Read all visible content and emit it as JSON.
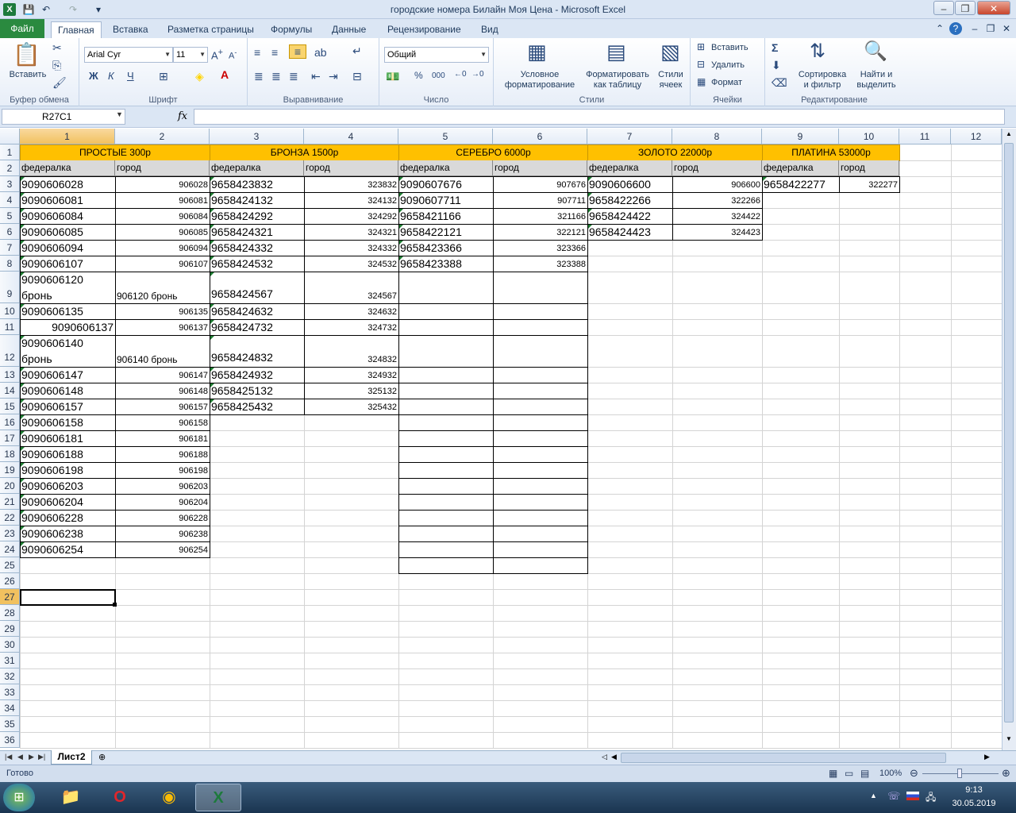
{
  "window": {
    "title": "городские номера Билайн Моя Цена  -  Microsoft Excel",
    "minimize": "–",
    "restore": "❐",
    "close": "✕"
  },
  "ribbon_tabs": [
    "Файл",
    "Главная",
    "Вставка",
    "Разметка страницы",
    "Формулы",
    "Данные",
    "Рецензирование",
    "Вид"
  ],
  "ribbon": {
    "paste": "Вставить",
    "clipboard": "Буфер обмена",
    "font_name": "Arial Cyr",
    "font_size": "11",
    "bold": "Ж",
    "italic": "К",
    "underline": "Ч",
    "font_group": "Шрифт",
    "align_group": "Выравнивание",
    "number_format": "Общий",
    "percent": "%",
    "thousands": "000",
    "number_group": "Число",
    "cond_format_1": "Условное",
    "cond_format_2": "форматирование",
    "format_table_1": "Форматировать",
    "format_table_2": "как таблицу",
    "cell_styles_1": "Стили",
    "cell_styles_2": "ячеек",
    "styles_group": "Стили",
    "insert": "Вставить",
    "delete": "Удалить",
    "format": "Формат",
    "cells_group": "Ячейки",
    "sort_1": "Сортировка",
    "sort_2": "и фильтр",
    "find_1": "Найти и",
    "find_2": "выделить",
    "edit_group": "Редактирование"
  },
  "formula_bar": {
    "name_box": "R27C1",
    "fx": "fx",
    "formula": ""
  },
  "columns": [
    "1",
    "2",
    "3",
    "4",
    "5",
    "6",
    "7",
    "8",
    "9",
    "10",
    "11",
    "12"
  ],
  "rows": [
    "1",
    "2",
    "3",
    "4",
    "5",
    "6",
    "7",
    "8",
    "9",
    "10",
    "11",
    "12",
    "13",
    "14",
    "15",
    "16",
    "17",
    "18",
    "19",
    "20",
    "21",
    "22",
    "23",
    "24",
    "25",
    "26",
    "27",
    "28",
    "29",
    "30",
    "31",
    "32",
    "33",
    "34",
    "35",
    "36"
  ],
  "headers": {
    "prostye": "ПРОСТЫЕ 300р",
    "bronza": "БРОНЗА 1500р",
    "serebro": "СЕРЕБРО 6000р",
    "zoloto": "ЗОЛОТО 22000р",
    "platina": "ПЛАТИНА 53000р",
    "federalka": "федералка",
    "gorod": "город"
  },
  "data": {
    "prostye": [
      [
        "9090606028",
        "906028"
      ],
      [
        "9090606081",
        "906081"
      ],
      [
        "9090606084",
        "906084"
      ],
      [
        "9090606085",
        "906085"
      ],
      [
        "9090606094",
        "906094"
      ],
      [
        "9090606107",
        "906107"
      ],
      [
        "9090606120 бронь",
        "906120 бронь"
      ],
      [
        "9090606135",
        "906135"
      ],
      [
        "9090606137",
        "906137"
      ],
      [
        "9090606140 бронь",
        "906140 бронь"
      ],
      [
        "9090606147",
        "906147"
      ],
      [
        "9090606148",
        "906148"
      ],
      [
        "9090606157",
        "906157"
      ],
      [
        "9090606158",
        "906158"
      ],
      [
        "9090606181",
        "906181"
      ],
      [
        "9090606188",
        "906188"
      ],
      [
        "9090606198",
        "906198"
      ],
      [
        "9090606203",
        "906203"
      ],
      [
        "9090606204",
        "906204"
      ],
      [
        "9090606228",
        "906228"
      ],
      [
        "9090606238",
        "906238"
      ],
      [
        "9090606254",
        "906254"
      ]
    ],
    "bronza": [
      [
        "9658423832",
        "323832"
      ],
      [
        "9658424132",
        "324132"
      ],
      [
        "9658424292",
        "324292"
      ],
      [
        "9658424321",
        "324321"
      ],
      [
        "9658424332",
        "324332"
      ],
      [
        "9658424532",
        "324532"
      ],
      [
        "9658424567",
        "324567"
      ],
      [
        "9658424632",
        "324632"
      ],
      [
        "9658424732",
        "324732"
      ],
      [
        "9658424832",
        "324832"
      ],
      [
        "9658424932",
        "324932"
      ],
      [
        "9658425132",
        "325132"
      ],
      [
        "9658425432",
        "325432"
      ]
    ],
    "serebro": [
      [
        "9090607676",
        "907676"
      ],
      [
        "9090607711",
        "907711"
      ],
      [
        "9658421166",
        "321166"
      ],
      [
        "9658422121",
        "322121"
      ],
      [
        "9658423366",
        "323366"
      ],
      [
        "9658423388",
        "323388"
      ]
    ],
    "zoloto": [
      [
        "9090606600",
        "906600"
      ],
      [
        "9658422266",
        "322266"
      ],
      [
        "9658424422",
        "324422"
      ],
      [
        "9658424423",
        "324423"
      ]
    ],
    "platina": [
      [
        "9658422277",
        "322277"
      ]
    ]
  },
  "sheet_tab": "Лист2",
  "status": {
    "ready": "Готово",
    "zoom": "100%"
  },
  "taskbar": {
    "time": "9:13",
    "date": "30.05.2019"
  }
}
